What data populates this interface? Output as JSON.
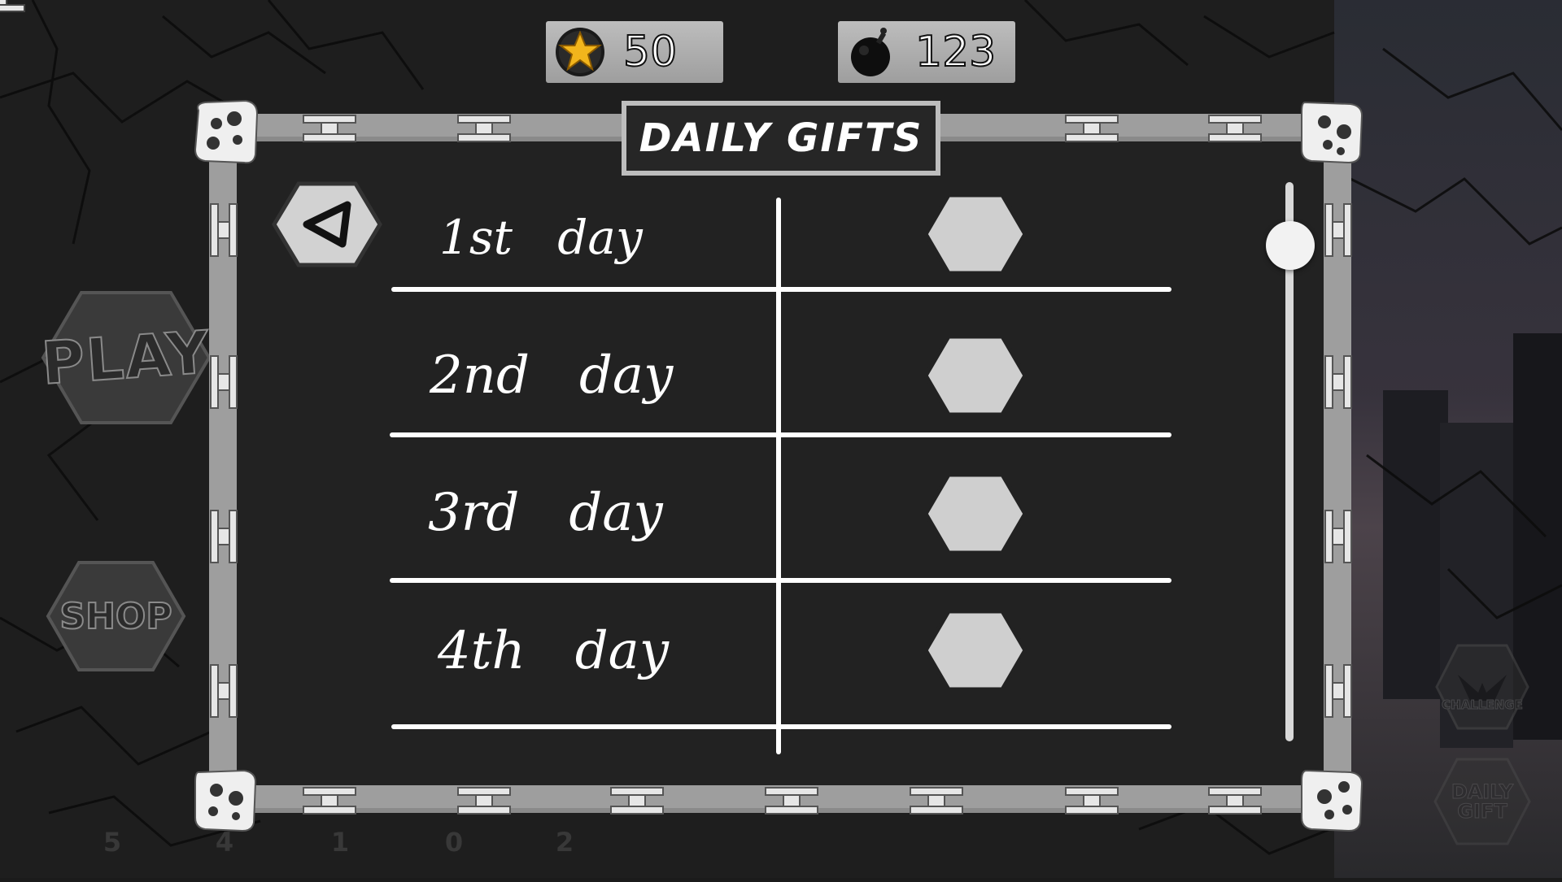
{
  "hud": {
    "stars": {
      "value": "50",
      "icon": "star-coin-icon",
      "color": "#f2b51c"
    },
    "bombs": {
      "value": "123",
      "icon": "bomb-icon"
    }
  },
  "menu": {
    "play_label": "PLAY",
    "shop_label": "SHOP",
    "challenge_label": "CHALLENGE",
    "daily_gift_label": "DAILY GIFT",
    "tray_counts": [
      "5",
      "4",
      "1",
      "0",
      "2"
    ]
  },
  "dialog": {
    "title": "DAILY GIFTS",
    "back_icon": "back-arrow-icon",
    "days": [
      {
        "label": "1st   day"
      },
      {
        "label": "2nd   day"
      },
      {
        "label": "3rd   day"
      },
      {
        "label": "4th   day"
      }
    ],
    "scroll_position": 0.0
  },
  "colors": {
    "panel_bg": "#222222",
    "frame": "#9a9a9a",
    "slot": "#cfcfcf",
    "chalk": "#ffffff"
  }
}
